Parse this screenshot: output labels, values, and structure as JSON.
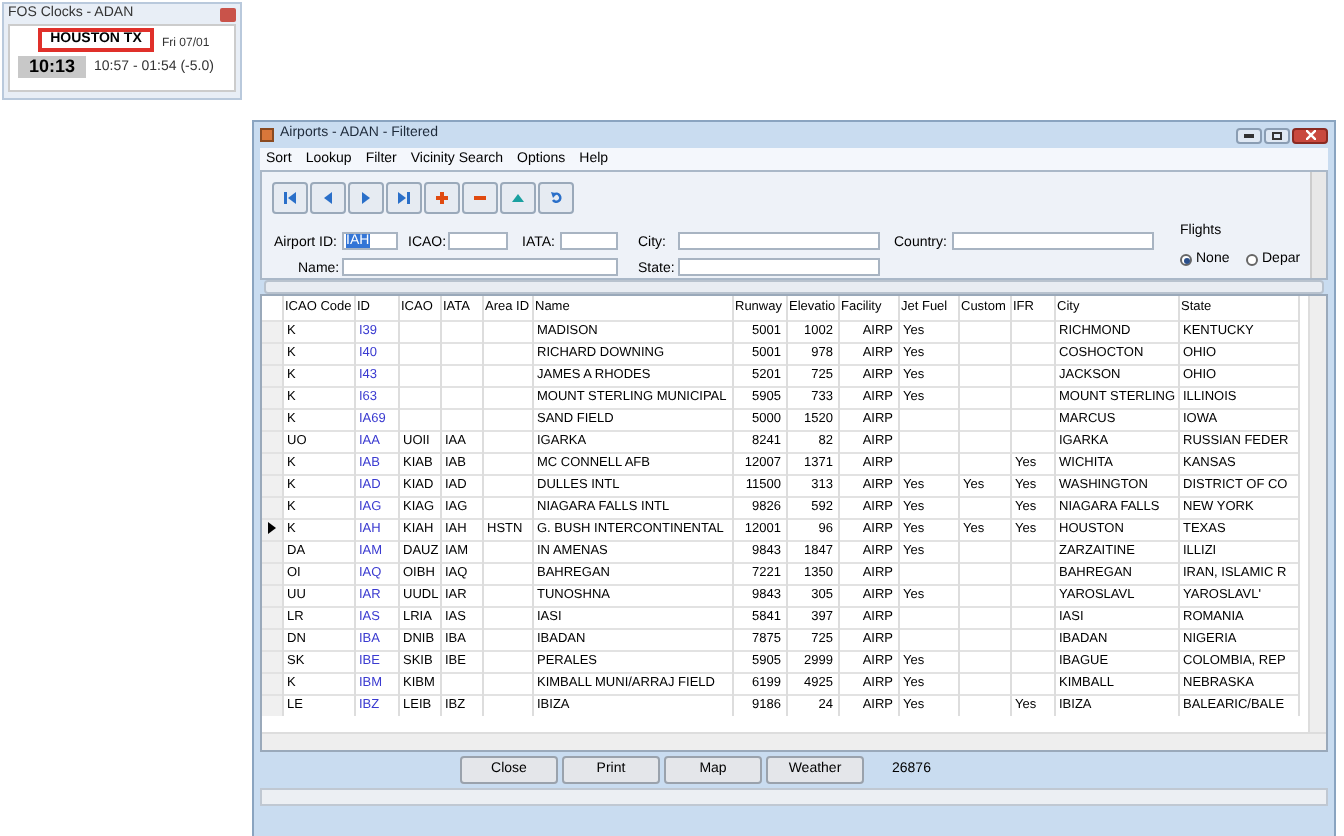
{
  "clock": {
    "title": "FOS Clocks - ADAN",
    "city": "HOUSTON TX",
    "time": "10:13",
    "date": "Fri 07/01",
    "range": "10:57 - 01:54 (-5.0)"
  },
  "window": {
    "title": "Airports - ADAN - Filtered"
  },
  "menu": [
    "Sort",
    "Lookup",
    "Filter",
    "Vicinity Search",
    "Options",
    "Help"
  ],
  "toolbar": [
    {
      "kind": "first"
    },
    {
      "kind": "prev"
    },
    {
      "kind": "next"
    },
    {
      "kind": "last"
    },
    {
      "kind": "add"
    },
    {
      "kind": "remove"
    },
    {
      "kind": "up"
    },
    {
      "kind": "refresh"
    }
  ],
  "form": {
    "airport_id": {
      "label": "Airport ID:",
      "value": "IAH"
    },
    "icao": {
      "label": "ICAO:"
    },
    "iata": {
      "label": "IATA:"
    },
    "city": {
      "label": "City:"
    },
    "country": {
      "label": "Country:"
    },
    "name": {
      "label": "Name:"
    },
    "state": {
      "label": "State:"
    },
    "flights": {
      "title": "Flights",
      "options": [
        {
          "label": "None",
          "selected": true
        },
        {
          "label": "Depar",
          "selected": false
        }
      ]
    }
  },
  "table": {
    "columns": [
      "ICAO Code",
      "ID",
      "ICAO",
      "IATA",
      "Area ID",
      "Name",
      "Runway",
      "Elevatio",
      "Facility",
      "Jet Fuel",
      "Custom",
      "IFR",
      "City",
      "State"
    ],
    "rows": [
      {
        "selected": false,
        "cells": [
          "K",
          "I39",
          "",
          "",
          "",
          "MADISON",
          "5001",
          "1002",
          "AIRP",
          "Yes",
          "",
          "",
          "RICHMOND",
          "KENTUCKY"
        ]
      },
      {
        "selected": false,
        "cells": [
          "K",
          "I40",
          "",
          "",
          "",
          "RICHARD DOWNING",
          "5001",
          "978",
          "AIRP",
          "Yes",
          "",
          "",
          "COSHOCTON",
          "OHIO"
        ]
      },
      {
        "selected": false,
        "cells": [
          "K",
          "I43",
          "",
          "",
          "",
          "JAMES A RHODES",
          "5201",
          "725",
          "AIRP",
          "Yes",
          "",
          "",
          "JACKSON",
          "OHIO"
        ]
      },
      {
        "selected": false,
        "cells": [
          "K",
          "I63",
          "",
          "",
          "",
          "MOUNT STERLING MUNICIPAL",
          "5905",
          "733",
          "AIRP",
          "Yes",
          "",
          "",
          "MOUNT STERLING",
          "ILLINOIS"
        ]
      },
      {
        "selected": false,
        "cells": [
          "K",
          "IA69",
          "",
          "",
          "",
          "SAND FIELD",
          "5000",
          "1520",
          "AIRP",
          "",
          "",
          "",
          "MARCUS",
          "IOWA"
        ]
      },
      {
        "selected": false,
        "cells": [
          "UO",
          "IAA",
          "UOII",
          "IAA",
          "",
          "IGARKA",
          "8241",
          "82",
          "AIRP",
          "",
          "",
          "",
          "IGARKA",
          "RUSSIAN FEDER"
        ]
      },
      {
        "selected": false,
        "cells": [
          "K",
          "IAB",
          "KIAB",
          "IAB",
          "",
          "MC CONNELL AFB",
          "12007",
          "1371",
          "AIRP",
          "",
          "",
          "Yes",
          "WICHITA",
          "KANSAS"
        ]
      },
      {
        "selected": false,
        "cells": [
          "K",
          "IAD",
          "KIAD",
          "IAD",
          "",
          "DULLES INTL",
          "11500",
          "313",
          "AIRP",
          "Yes",
          "Yes",
          "Yes",
          "WASHINGTON",
          "DISTRICT OF CO"
        ]
      },
      {
        "selected": false,
        "cells": [
          "K",
          "IAG",
          "KIAG",
          "IAG",
          "",
          "NIAGARA FALLS INTL",
          "9826",
          "592",
          "AIRP",
          "Yes",
          "",
          "Yes",
          "NIAGARA FALLS",
          "NEW YORK"
        ]
      },
      {
        "selected": true,
        "cells": [
          "K",
          "IAH",
          "KIAH",
          "IAH",
          "HSTN",
          "G. BUSH INTERCONTINENTAL",
          "12001",
          "96",
          "AIRP",
          "Yes",
          "Yes",
          "Yes",
          "HOUSTON",
          "TEXAS"
        ]
      },
      {
        "selected": false,
        "cells": [
          "DA",
          "IAM",
          "DAUZ",
          "IAM",
          "",
          "IN AMENAS",
          "9843",
          "1847",
          "AIRP",
          "Yes",
          "",
          "",
          "ZARZAITINE",
          "ILLIZI"
        ]
      },
      {
        "selected": false,
        "cells": [
          "OI",
          "IAQ",
          "OIBH",
          "IAQ",
          "",
          "BAHREGAN",
          "7221",
          "1350",
          "AIRP",
          "",
          "",
          "",
          "BAHREGAN",
          "IRAN, ISLAMIC R"
        ]
      },
      {
        "selected": false,
        "cells": [
          "UU",
          "IAR",
          "UUDL",
          "IAR",
          "",
          "TUNOSHNA",
          "9843",
          "305",
          "AIRP",
          "Yes",
          "",
          "",
          "YAROSLAVL",
          "YAROSLAVL'"
        ]
      },
      {
        "selected": false,
        "cells": [
          "LR",
          "IAS",
          "LRIA",
          "IAS",
          "",
          "IASI",
          "5841",
          "397",
          "AIRP",
          "",
          "",
          "",
          "IASI",
          "ROMANIA"
        ]
      },
      {
        "selected": false,
        "cells": [
          "DN",
          "IBA",
          "DNIB",
          "IBA",
          "",
          "IBADAN",
          "7875",
          "725",
          "AIRP",
          "",
          "",
          "",
          "IBADAN",
          "NIGERIA"
        ]
      },
      {
        "selected": false,
        "cells": [
          "SK",
          "IBE",
          "SKIB",
          "IBE",
          "",
          "PERALES",
          "5905",
          "2999",
          "AIRP",
          "Yes",
          "",
          "",
          "IBAGUE",
          "COLOMBIA, REP"
        ]
      },
      {
        "selected": false,
        "cells": [
          "K",
          "IBM",
          "KIBM",
          "",
          "",
          "KIMBALL MUNI/ARRAJ FIELD",
          "6199",
          "4925",
          "AIRP",
          "Yes",
          "",
          "",
          "KIMBALL",
          "NEBRASKA"
        ]
      },
      {
        "selected": false,
        "cells": [
          "LE",
          "IBZ",
          "LEIB",
          "IBZ",
          "",
          "IBIZA",
          "9186",
          "24",
          "AIRP",
          "Yes",
          "",
          "Yes",
          "IBIZA",
          "BALEARIC/BALE"
        ]
      }
    ]
  },
  "buttons": [
    "Close",
    "Print",
    "Map",
    "Weather"
  ],
  "status": {
    "count": "26876"
  }
}
